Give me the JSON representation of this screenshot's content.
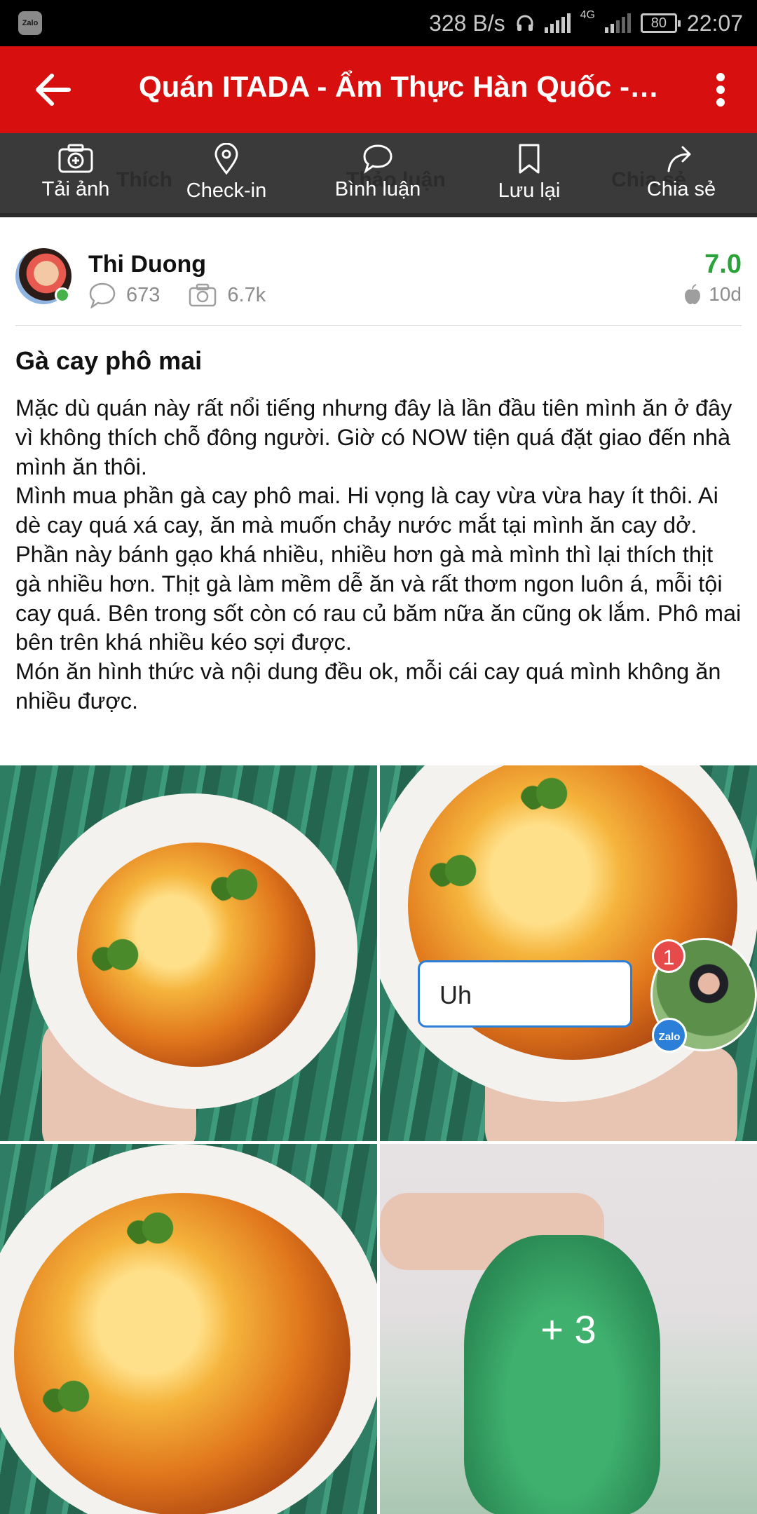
{
  "status_bar": {
    "app_badge": "Zalo",
    "network_speed": "328 B/s",
    "network_type": "4G",
    "battery": "80",
    "time": "22:07"
  },
  "header": {
    "title": "Quán ITADA - Ẩm Thực Hàn Quốc - Đ...",
    "accent_color": "#d70f0f"
  },
  "actions": {
    "ghost_labels": [
      "Thích",
      "Thảo luận",
      "Chia sẻ"
    ],
    "items": [
      {
        "label": "Tải ảnh",
        "icon": "camera-add-icon"
      },
      {
        "label": "Check-in",
        "icon": "location-pin-icon"
      },
      {
        "label": "Bình luận",
        "icon": "comment-icon"
      },
      {
        "label": "Lưu lại",
        "icon": "bookmark-icon"
      },
      {
        "label": "Chia sẻ",
        "icon": "share-icon"
      }
    ]
  },
  "author": {
    "name": "Thi Duong",
    "comments": "673",
    "photos": "6.7k",
    "score": "7.0",
    "time": "10d",
    "score_color": "#2aa43a"
  },
  "review": {
    "title": "Gà cay phô mai",
    "paragraphs": [
      "Mặc dù quán này rất nổi tiếng nhưng đây là lần đầu tiên mình ăn ở đây vì không thích chỗ đông người. Giờ có NOW tiện quá đặt giao đến nhà mình ăn thôi.",
      "Mình mua phần gà cay phô mai. Hi vọng là cay vừa vừa hay ít thôi. Ai dè cay quá xá cay, ăn mà muốn chảy nước mắt tại mình ăn cay dở.",
      "Phần này bánh gạo khá nhiều, nhiều hơn gà mà mình thì lại thích thịt gà nhiều hơn. Thịt gà làm mềm dễ ăn và rất thơm ngon luôn á, mỗi tội cay quá. Bên trong sốt còn có rau củ băm nữa ăn cũng ok lắm. Phô mai bên trên khá nhiều kéo sợi được.",
      "Món ăn hình thức và nội dung đều ok, mỗi cái cay quá mình không ăn nhiều được."
    ]
  },
  "photos": {
    "more_count": "+ 3"
  },
  "chat_overlay": {
    "input_text": "Uh",
    "unread_badge": "1",
    "app_badge": "Zalo"
  }
}
